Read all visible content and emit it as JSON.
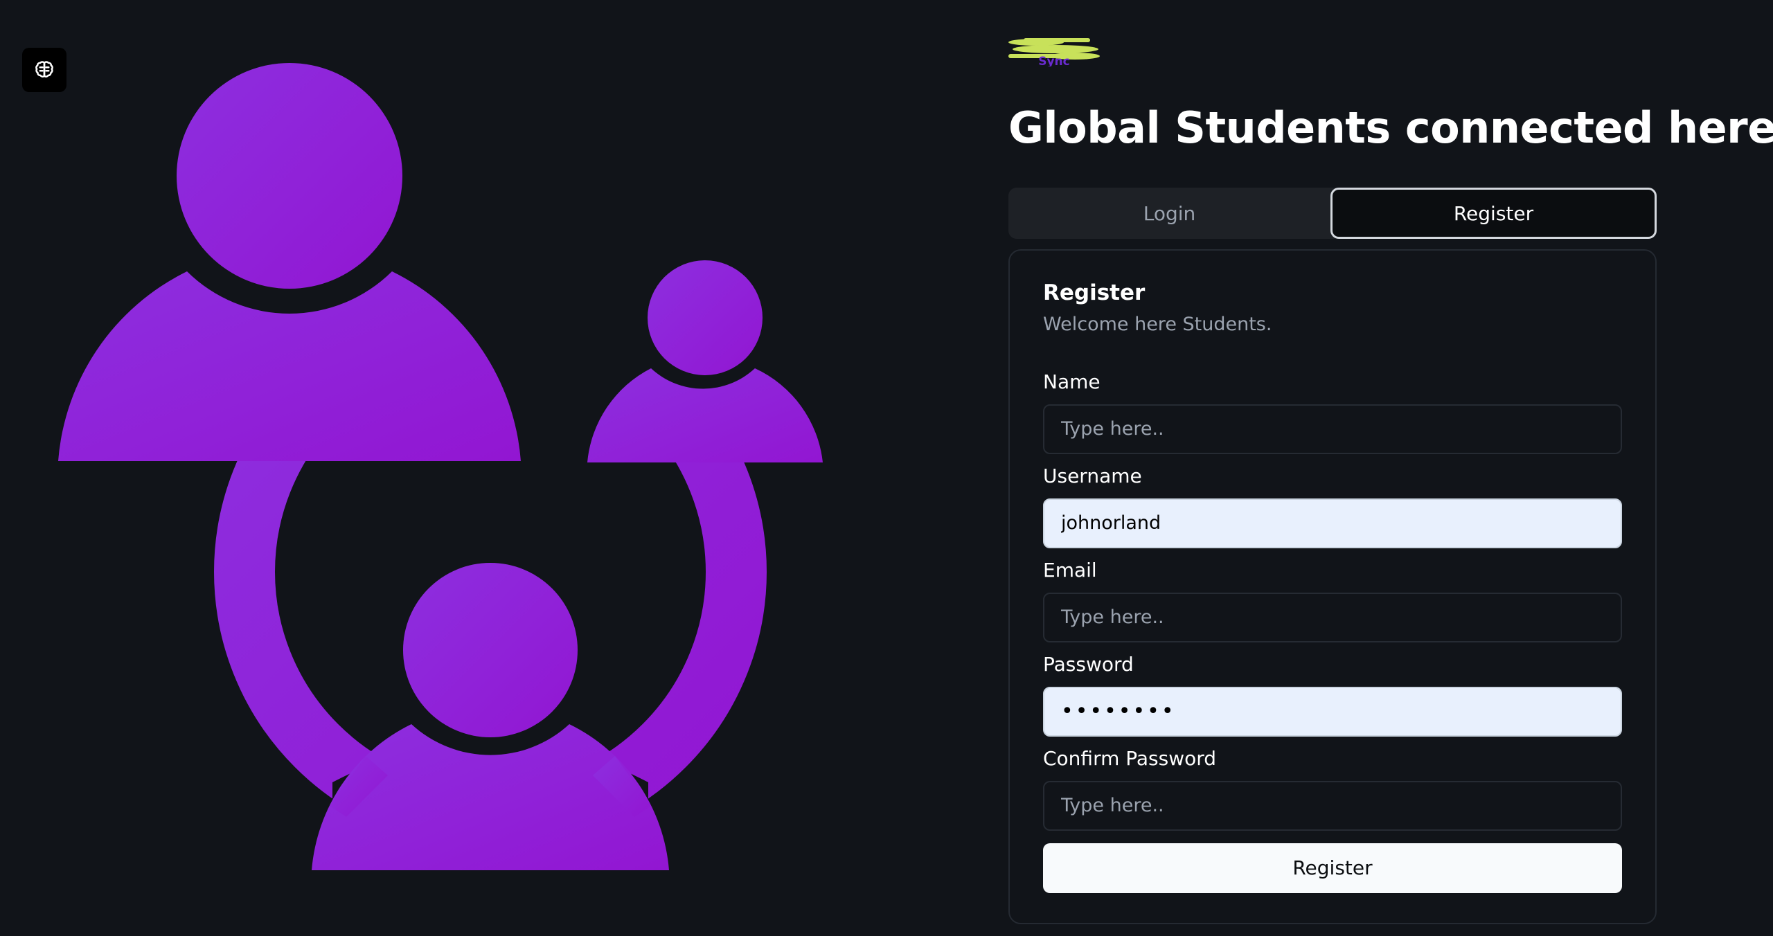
{
  "app": {
    "logo_text": "Sync",
    "headline": "Global Students connected here",
    "colors": {
      "background": "#111419",
      "accent_purple": "#8f1fd6",
      "logo_green": "#c8e15a",
      "logo_purple": "#6a2bd0"
    }
  },
  "icons": {
    "toggle_button": "brain-icon",
    "hero_illustration": "students-group-icon"
  },
  "tabs": [
    {
      "label": "Login",
      "active": false
    },
    {
      "label": "Register",
      "active": true
    }
  ],
  "card": {
    "title": "Register",
    "subtitle": "Welcome here Students."
  },
  "form": {
    "fields": [
      {
        "label": "Name",
        "placeholder": "Type here..",
        "value": ""
      },
      {
        "label": "Username",
        "placeholder": "Type here..",
        "value": "johnorland"
      },
      {
        "label": "Email",
        "placeholder": "Type here..",
        "value": ""
      },
      {
        "label": "Password",
        "placeholder": "Type here..",
        "value": "••••••••"
      },
      {
        "label": "Confirm Password",
        "placeholder": "Type here..",
        "value": ""
      }
    ],
    "submit_label": "Register"
  }
}
